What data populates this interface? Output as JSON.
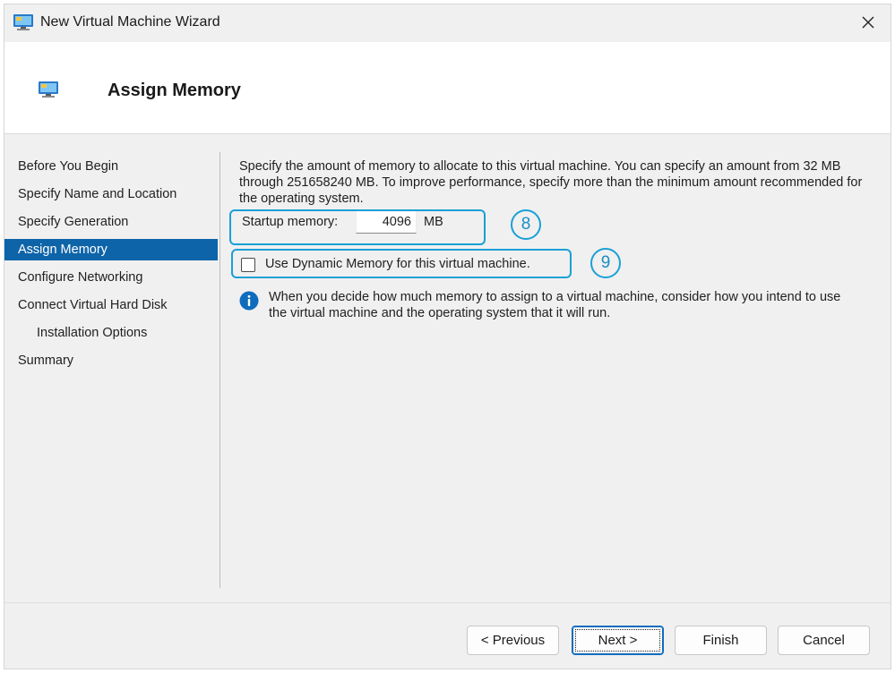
{
  "window": {
    "title": "New Virtual Machine Wizard"
  },
  "header": {
    "title": "Assign Memory"
  },
  "nav": {
    "items": [
      {
        "label": "Before You Begin",
        "selected": false,
        "indent": false
      },
      {
        "label": "Specify Name and Location",
        "selected": false,
        "indent": false
      },
      {
        "label": "Specify Generation",
        "selected": false,
        "indent": false
      },
      {
        "label": "Assign Memory",
        "selected": true,
        "indent": false
      },
      {
        "label": "Configure Networking",
        "selected": false,
        "indent": false
      },
      {
        "label": "Connect Virtual Hard Disk",
        "selected": false,
        "indent": false
      },
      {
        "label": "Installation Options",
        "selected": false,
        "indent": true
      },
      {
        "label": "Summary",
        "selected": false,
        "indent": false
      }
    ]
  },
  "content": {
    "description": "Specify the amount of memory to allocate to this virtual machine. You can specify an amount from 32 MB through 251658240 MB. To improve performance, specify more than the minimum amount recommended for the operating system.",
    "startup_memory_label": "Startup memory:",
    "startup_memory_value": "4096",
    "startup_memory_unit": "MB",
    "dynamic_memory_label": "Use Dynamic Memory for this virtual machine.",
    "dynamic_memory_checked": false,
    "info_text": "When you decide how much memory to assign to a virtual machine, consider how you intend to use the virtual machine and the operating system that it will run."
  },
  "annotations": {
    "callout_8": "8",
    "callout_9": "9"
  },
  "buttons": {
    "previous": "< Previous",
    "next": "Next >",
    "finish": "Finish",
    "cancel": "Cancel"
  },
  "colors": {
    "selection": "#0e64a8",
    "callout": "#1aa0d6",
    "info_icon": "#0f6cbd"
  },
  "icons": {
    "window": "virtual-machine-icon",
    "header": "virtual-machine-icon",
    "close": "close-icon",
    "info": "info-icon"
  }
}
